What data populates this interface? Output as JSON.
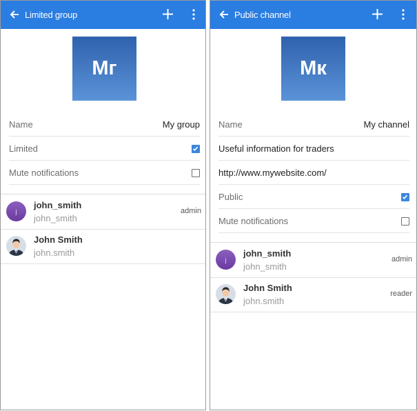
{
  "left": {
    "appbar": {
      "title": "Limited group"
    },
    "avatar_initials": "Мг",
    "fields": {
      "name_label": "Name",
      "name_value": "My group",
      "limited_label": "Limited",
      "limited_checked": true,
      "mute_label": "Mute notifications",
      "mute_checked": false
    },
    "members": [
      {
        "name": "john_smith",
        "login": "john_smith",
        "role": "admin",
        "avatar": "j"
      },
      {
        "name": "John Smith",
        "login": "john.smith",
        "role": "",
        "avatar": "photo"
      }
    ]
  },
  "right": {
    "appbar": {
      "title": "Public channel"
    },
    "avatar_initials": "Мк",
    "fields": {
      "name_label": "Name",
      "name_value": "My channel",
      "description": "Useful information for traders",
      "url": "http://www.mywebsite.com/",
      "public_label": "Public",
      "public_checked": true,
      "mute_label": "Mute notifications",
      "mute_checked": false
    },
    "members": [
      {
        "name": "john_smith",
        "login": "john_smith",
        "role": "admin",
        "avatar": "j"
      },
      {
        "name": "John Smith",
        "login": "john.smith",
        "role": "reader",
        "avatar": "photo"
      }
    ]
  },
  "icons": {
    "back": "arrow-back-icon",
    "add": "plus-icon",
    "more": "more-vert-icon",
    "check": "check-icon"
  },
  "colors": {
    "appbar": "#2a7de1",
    "accent": "#3b86de",
    "avatar_gradient_top": "#2f62ad",
    "avatar_gradient_bottom": "#5b93d8",
    "member_avatar_purple": "#7c4db0"
  }
}
